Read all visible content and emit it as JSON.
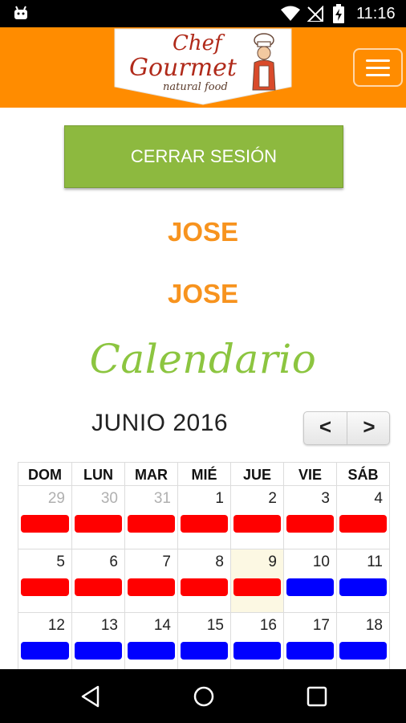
{
  "status_bar": {
    "time": "11:16"
  },
  "header": {
    "logo_text_line1": "Chef",
    "logo_text_line2": "Gourmet",
    "logo_text_line3": "natural food"
  },
  "logout_label": "CERRAR SESIÓN",
  "user": {
    "first_line": "JOSE",
    "second_line": "JOSE"
  },
  "calendar": {
    "title": "Calendario",
    "month": "JUNIO 2016",
    "prev_label": "<",
    "next_label": ">",
    "weekdays": [
      "DOM",
      "LUN",
      "MAR",
      "MIÉ",
      "JUE",
      "VIE",
      "SÁB"
    ],
    "weeks": [
      [
        {
          "day": "29",
          "other": true,
          "event": "red"
        },
        {
          "day": "30",
          "other": true,
          "event": "red"
        },
        {
          "day": "31",
          "other": true,
          "event": "red"
        },
        {
          "day": "1",
          "other": false,
          "event": "red"
        },
        {
          "day": "2",
          "other": false,
          "event": "red"
        },
        {
          "day": "3",
          "other": false,
          "event": "red"
        },
        {
          "day": "4",
          "other": false,
          "event": "red"
        }
      ],
      [
        {
          "day": "5",
          "other": false,
          "event": "red"
        },
        {
          "day": "6",
          "other": false,
          "event": "red"
        },
        {
          "day": "7",
          "other": false,
          "event": "red"
        },
        {
          "day": "8",
          "other": false,
          "event": "red"
        },
        {
          "day": "9",
          "other": false,
          "event": "red",
          "today": true
        },
        {
          "day": "10",
          "other": false,
          "event": "blue"
        },
        {
          "day": "11",
          "other": false,
          "event": "blue"
        }
      ],
      [
        {
          "day": "12",
          "other": false,
          "event": "blue"
        },
        {
          "day": "13",
          "other": false,
          "event": "blue"
        },
        {
          "day": "14",
          "other": false,
          "event": "blue"
        },
        {
          "day": "15",
          "other": false,
          "event": "blue"
        },
        {
          "day": "16",
          "other": false,
          "event": "blue"
        },
        {
          "day": "17",
          "other": false,
          "event": "blue"
        },
        {
          "day": "18",
          "other": false,
          "event": "blue"
        }
      ]
    ],
    "colors": {
      "red": "#ff0000",
      "blue": "#0000ff",
      "today_bg": "#fcf8e3"
    }
  },
  "colors": {
    "header": "#ff8c00",
    "logout_button": "#8db93f",
    "user_name": "#f7931e",
    "calendar_title": "#8cc540"
  },
  "icons": {
    "status": [
      "android-icon",
      "wifi-icon",
      "signal-off-icon",
      "battery-charging-icon"
    ],
    "nav": [
      "back-icon",
      "home-icon",
      "recents-icon"
    ]
  }
}
